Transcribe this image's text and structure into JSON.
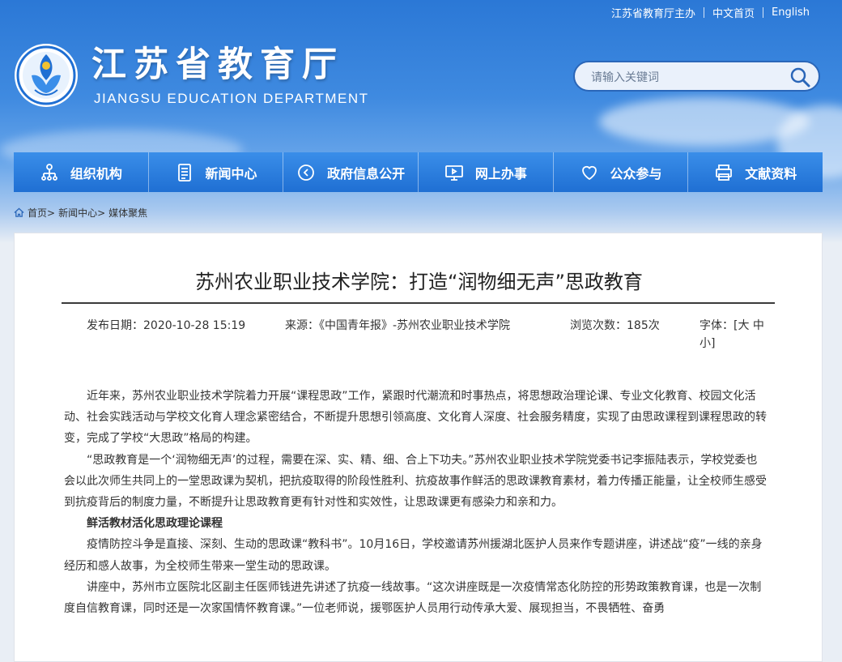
{
  "topbar": {
    "sponsor": "江苏省教育厅主办",
    "chinese": "中文首页",
    "english": "English"
  },
  "site": {
    "name_cn": "江苏省教育厅",
    "name_en": "JIANGSU EDUCATION DEPARTMENT"
  },
  "search": {
    "placeholder": "请输入关键词"
  },
  "nav": [
    {
      "label": "组织机构",
      "icon": "org-chart-icon"
    },
    {
      "label": "新闻中心",
      "icon": "document-icon"
    },
    {
      "label": "政府信息公开",
      "icon": "play-circle-icon"
    },
    {
      "label": "网上办事",
      "icon": "monitor-icon"
    },
    {
      "label": "公众参与",
      "icon": "heart-icon"
    },
    {
      "label": "文献资料",
      "icon": "printer-icon"
    }
  ],
  "breadcrumb": {
    "home": "首页>",
    "news": "新闻中心>",
    "current": "媒体聚焦"
  },
  "article": {
    "title": "苏州农业职业技术学院：打造“润物细无声”思政教育",
    "date": "发布日期：2020-10-28 15:19",
    "source": "来源：《中国青年报》-苏州农业职业技术学院",
    "views": "浏览次数：185次",
    "font_label": "字体：",
    "font_sizes": "[大 中 小]",
    "paragraphs": [
      {
        "type": "p",
        "text": "近年来，苏州农业职业技术学院着力开展“课程思政”工作，紧跟时代潮流和时事热点，将思想政治理论课、专业文化教育、校园文化活动、社会实践活动与学校文化育人理念紧密结合，不断提升思想引领高度、文化育人深度、社会服务精度，实现了由思政课程到课程思政的转变，完成了学校“大思政”格局的构建。"
      },
      {
        "type": "p",
        "text": "“思政教育是一个‘润物细无声’的过程，需要在深、实、精、细、合上下功夫。”苏州农业职业技术学院党委书记李振陆表示，学校党委也会以此次师生共同上的一堂思政课为契机，把抗疫取得的阶段性胜利、抗疫故事作鲜活的思政课教育素材，着力传播正能量，让全校师生感受到抗疫背后的制度力量，不断提升让思政教育更有针对性和实效性，让思政课更有感染力和亲和力。"
      },
      {
        "type": "h",
        "text": "鲜活教材活化思政理论课程"
      },
      {
        "type": "p",
        "text": "疫情防控斗争是直接、深刻、生动的思政课“教科书”。10月16日，学校邀请苏州援湖北医护人员来作专题讲座，讲述战“疫”一线的亲身经历和感人故事，为全校师生带来一堂生动的思政课。"
      },
      {
        "type": "p",
        "text": "讲座中，苏州市立医院北区副主任医师钱进先讲述了抗疫一线故事。“这次讲座既是一次疫情常态化防控的形势政策教育课，也是一次制度自信教育课，同时还是一次家国情怀教育课。”一位老师说，援鄂医护人员用行动传承大爱、展现担当，不畏牺牲、奋勇"
      }
    ]
  }
}
